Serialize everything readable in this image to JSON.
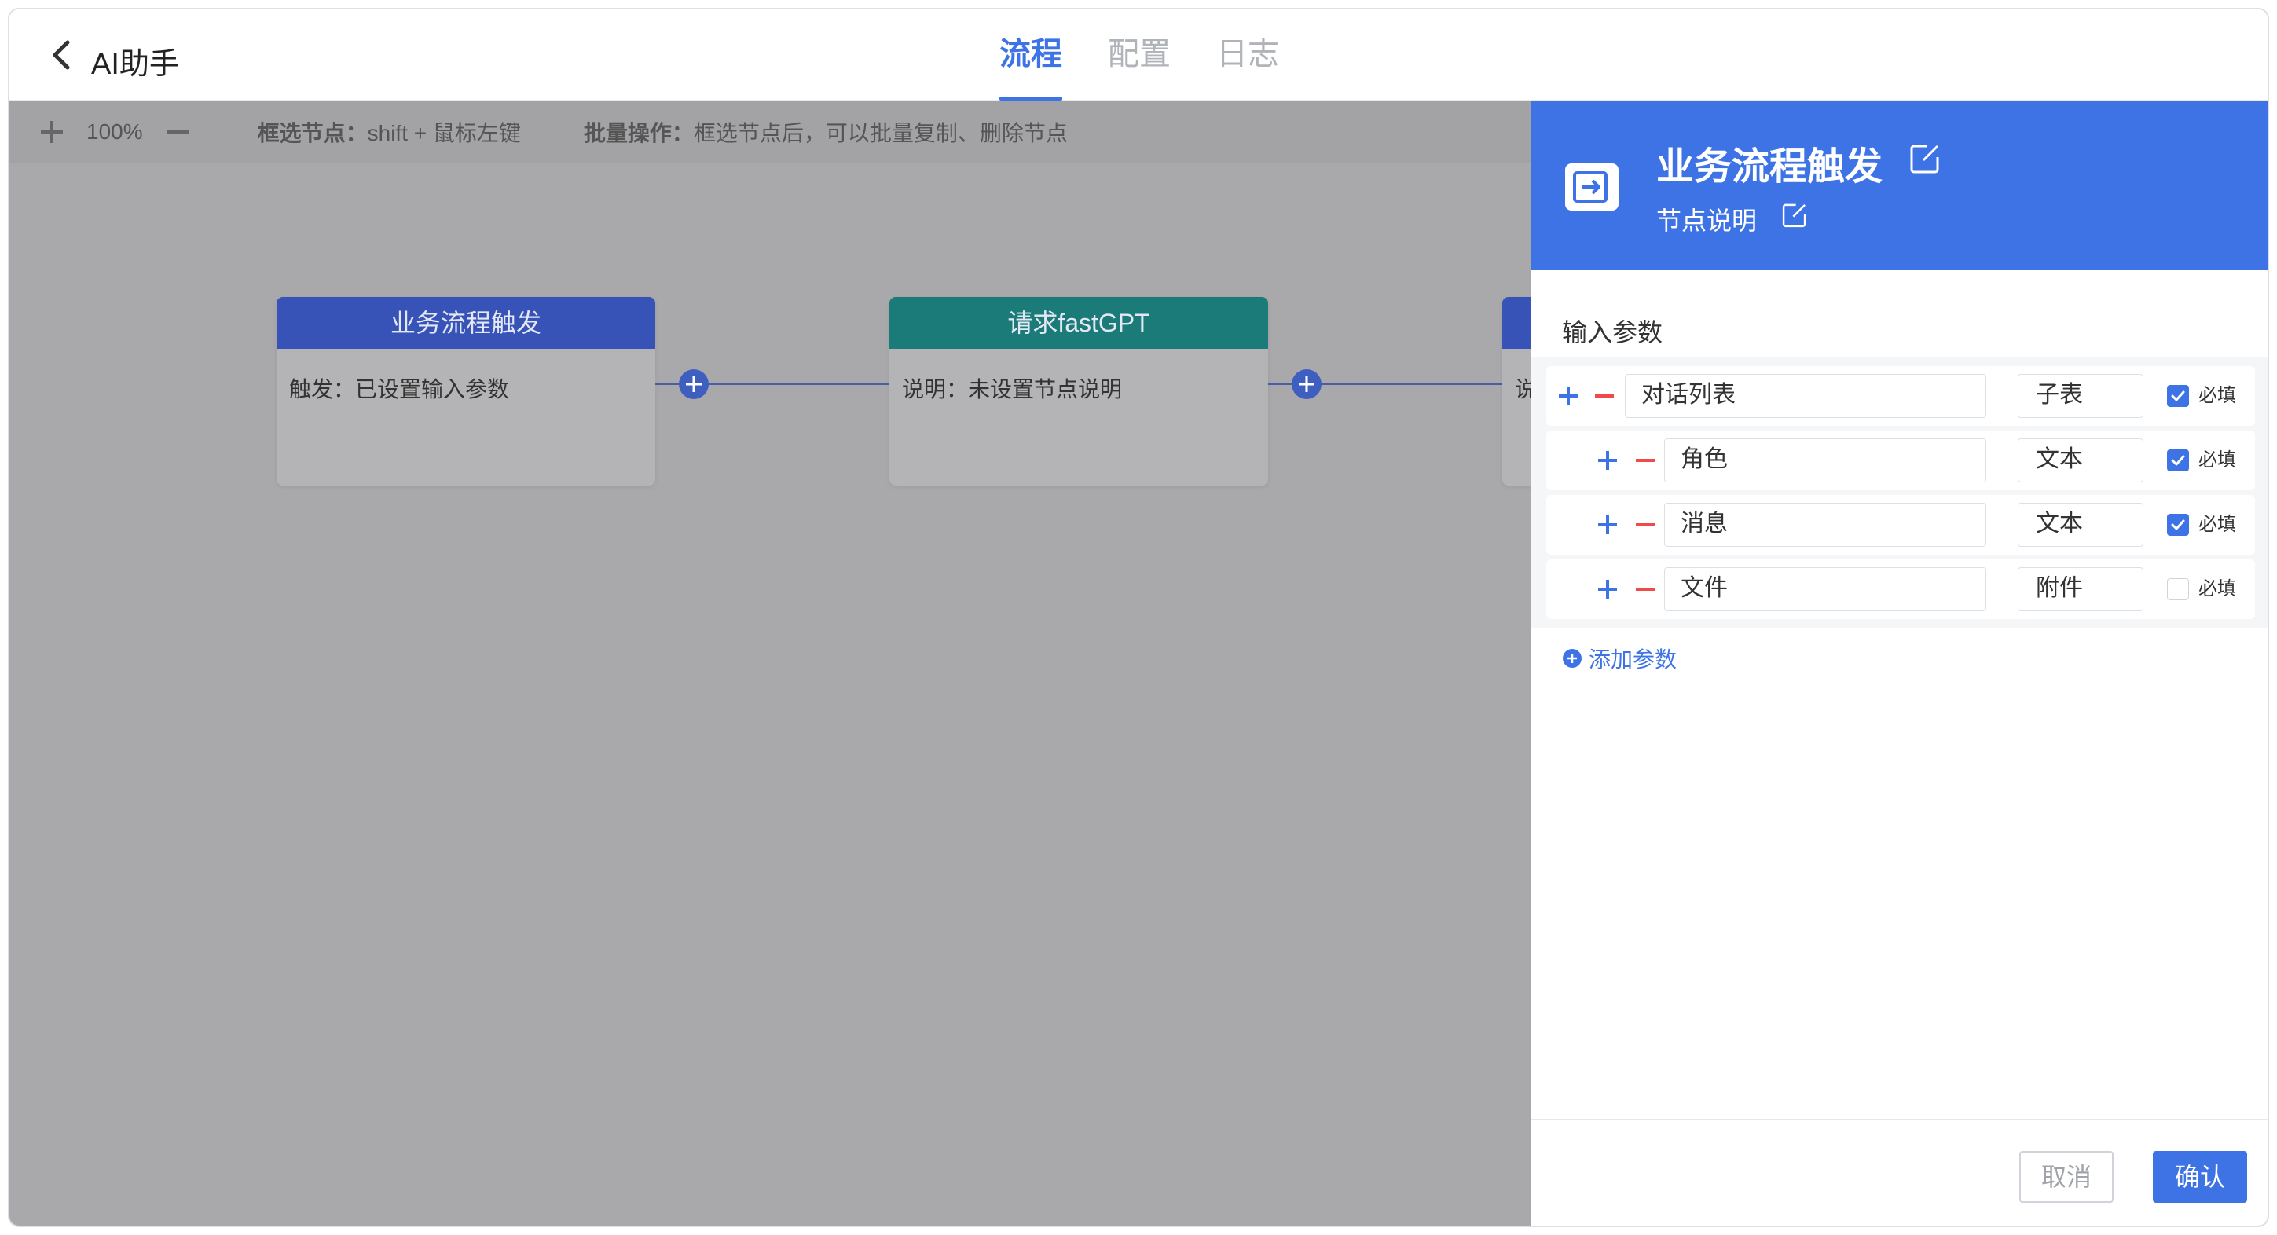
{
  "header": {
    "back_icon": "chevron-left-icon",
    "title": "AI助手",
    "tabs": [
      {
        "label": "流程",
        "active": true
      },
      {
        "label": "配置",
        "active": false
      },
      {
        "label": "日志",
        "active": false
      }
    ]
  },
  "toolbar": {
    "zoom": "100%",
    "hint1_label": "框选节点：",
    "hint1_text": "shift + 鼠标左键",
    "hint2_label": "批量操作：",
    "hint2_text": "框选节点后，可以批量复制、删除节点"
  },
  "nodes": [
    {
      "title": "业务流程触发",
      "body": "触发：已设置输入参数",
      "color": "#3753b8"
    },
    {
      "title": "请求fastGPT",
      "body": "说明：未设置节点说明",
      "color": "#1a7b78"
    },
    {
      "title": "",
      "body": "说",
      "color": "#3753b8"
    }
  ],
  "panel": {
    "title": "业务流程触发",
    "subtitle": "节点说明",
    "section_title": "输入参数",
    "params": [
      {
        "name": "对话列表",
        "type": "子表",
        "required": true,
        "level": 0
      },
      {
        "name": "角色",
        "type": "文本",
        "required": true,
        "level": 1
      },
      {
        "name": "消息",
        "type": "文本",
        "required": true,
        "level": 1
      },
      {
        "name": "文件",
        "type": "附件",
        "required": false,
        "level": 1
      }
    ],
    "required_label": "必填",
    "add_param": "添加参数",
    "cancel": "取消",
    "confirm": "确认"
  },
  "colors": {
    "accent": "#3e73e6",
    "danger": "#f04b4b",
    "trigger_node": "#3753b8",
    "gpt_node": "#1a7b78"
  }
}
